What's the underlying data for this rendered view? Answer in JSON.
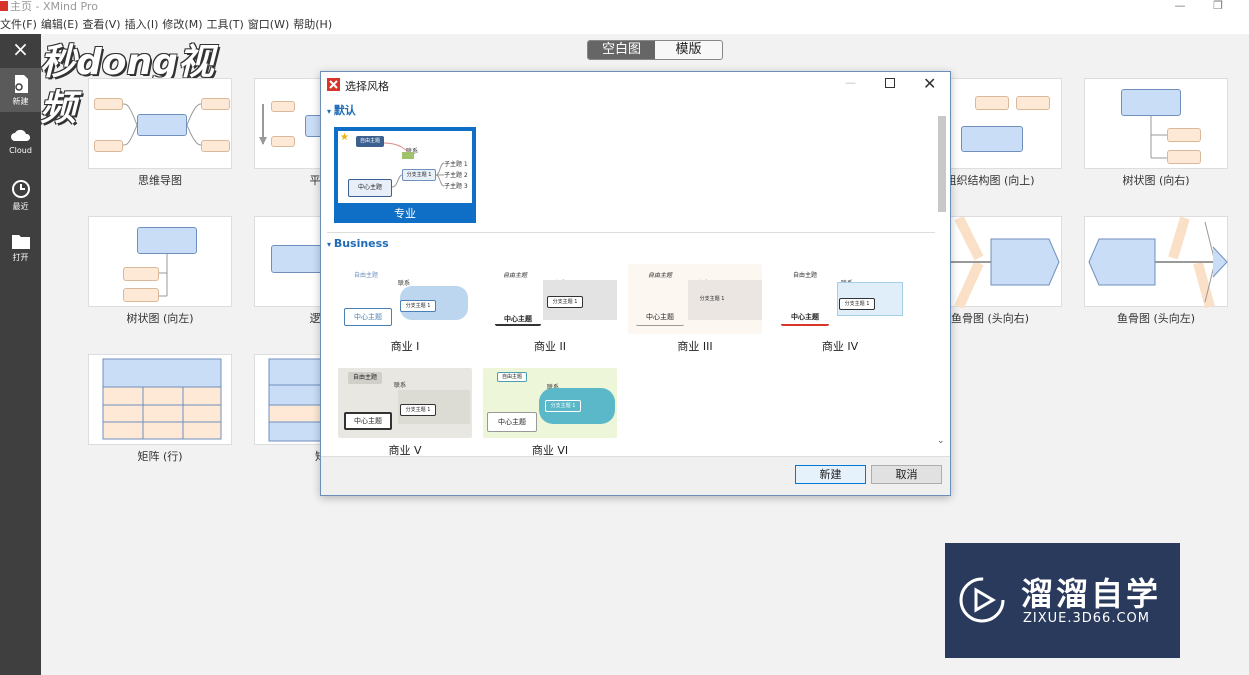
{
  "window": {
    "title": "主页 - XMind Pro"
  },
  "menu": [
    "文件(F)",
    "编辑(E)",
    "查看(V)",
    "插入(I)",
    "修改(M)",
    "工具(T)",
    "窗口(W)",
    "帮助(H)"
  ],
  "sidebar": {
    "close_icon": "×",
    "items": [
      {
        "label": "新建",
        "icon": "new-file-icon"
      },
      {
        "label": "Cloud",
        "icon": "cloud-icon"
      },
      {
        "label": "最近",
        "icon": "clock-icon"
      },
      {
        "label": "打开",
        "icon": "folder-icon"
      }
    ]
  },
  "overlay_logo": "秒dong视频",
  "toggle": {
    "blank": "空白图",
    "template": "模版"
  },
  "templates": [
    {
      "label": "思维导图"
    },
    {
      "label": "平衡图"
    },
    {
      "label": "组织结构图 (向上)"
    },
    {
      "label": "树状图 (向右)"
    },
    {
      "label": "树状图 (向左)"
    },
    {
      "label": "逻辑图"
    },
    {
      "label": "鱼骨图 (头向右)"
    },
    {
      "label": "鱼骨图 (头向左)"
    },
    {
      "label": "矩阵 (行)"
    },
    {
      "label": "矩阵"
    }
  ],
  "dialog": {
    "title": "选择风格",
    "sections": {
      "default": "默认",
      "business": "Business"
    },
    "default_style": {
      "label": "专业",
      "center": "中心主题",
      "free": "自由主题",
      "branch": "分支主题 1",
      "sub": [
        "子主题 1",
        "子主题 2",
        "子主题 3"
      ],
      "rel": "联系"
    },
    "styles": [
      {
        "label": "商业 I",
        "center": "中心主题",
        "free": "自由主题",
        "branch": "分支主题 1",
        "rel": "联系"
      },
      {
        "label": "商业 II",
        "center": "中心主题",
        "free": "自由主题",
        "branch": "分支主题 1",
        "rel": "联系"
      },
      {
        "label": "商业 III",
        "center": "中心主题",
        "free": "自由主题",
        "branch": "分支主题 1",
        "rel": "联系"
      },
      {
        "label": "商业 IV",
        "center": "中心主题",
        "free": "自由主题",
        "branch": "分支主题 1",
        "rel": "联系"
      },
      {
        "label": "商业 V",
        "center": "中心主题",
        "free": "自由主题",
        "branch": "分支主题 1",
        "rel": "联系"
      },
      {
        "label": "商业 VI",
        "center": "中心主题",
        "free": "自由主题",
        "branch": "分支主题 1",
        "rel": "联系"
      }
    ],
    "buttons": {
      "new": "新建",
      "cancel": "取消"
    }
  },
  "watermark": {
    "title": "溜溜自学",
    "url": "ZIXUE.3D66.COM"
  }
}
